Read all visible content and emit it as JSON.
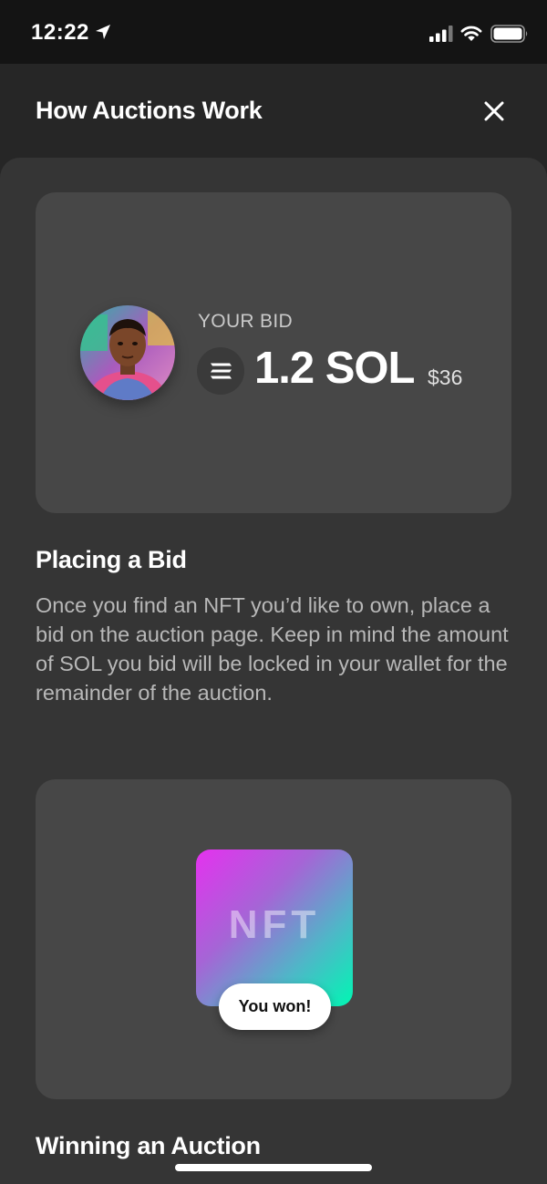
{
  "status_bar": {
    "time": "12:22",
    "icons": [
      "location-arrow-icon",
      "cellular-signal-icon",
      "wifi-icon",
      "battery-icon"
    ]
  },
  "header": {
    "title": "How Auctions Work",
    "close_icon": "close-icon"
  },
  "bid_card": {
    "label": "YOUR BID",
    "amount": "1.2 SOL",
    "usd": "$36",
    "token_icon": "solana-logo-icon"
  },
  "sections": [
    {
      "title": "Placing a Bid",
      "body": "Once you find an NFT you’d like to own, place a bid on the auction page. Keep in mind the amount of SOL you bid will be locked in your wallet for the remainder of the auction."
    },
    {
      "title": "Winning an Auction"
    }
  ],
  "win_card": {
    "nft_label": "NFT",
    "badge": "You won!"
  },
  "colors": {
    "status_bar_bg": "#141414",
    "header_bg": "#262626",
    "sheet_bg": "#353535",
    "card_bg": "#474747",
    "nft_gradient": [
      "#e531ef",
      "#00f7b3"
    ]
  }
}
